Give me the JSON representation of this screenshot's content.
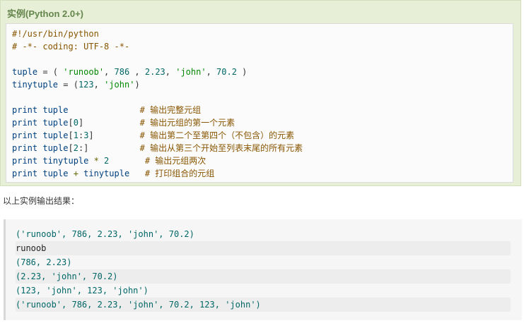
{
  "example": {
    "title": "实例(Python 2.0+)",
    "code_lines": [
      {
        "parts": [
          {
            "t": "#!/usr/bin/python",
            "c": "cm"
          }
        ]
      },
      {
        "parts": [
          {
            "t": "# -*- coding: UTF-8 -*-",
            "c": "cm"
          }
        ]
      },
      {
        "parts": []
      },
      {
        "parts": [
          {
            "t": "tuple",
            "c": "kw"
          },
          {
            "t": " = ( ",
            "c": "pl"
          },
          {
            "t": "'runoob'",
            "c": "str"
          },
          {
            "t": ", ",
            "c": "pl"
          },
          {
            "t": "786",
            "c": "num"
          },
          {
            "t": " , ",
            "c": "pl"
          },
          {
            "t": "2.23",
            "c": "num"
          },
          {
            "t": ", ",
            "c": "pl"
          },
          {
            "t": "'john'",
            "c": "str"
          },
          {
            "t": ", ",
            "c": "pl"
          },
          {
            "t": "70.2",
            "c": "num"
          },
          {
            "t": " )",
            "c": "pl"
          }
        ]
      },
      {
        "parts": [
          {
            "t": "tinytuple",
            "c": "kw"
          },
          {
            "t": " = (",
            "c": "pl"
          },
          {
            "t": "123",
            "c": "num"
          },
          {
            "t": ", ",
            "c": "pl"
          },
          {
            "t": "'john'",
            "c": "str"
          },
          {
            "t": ")",
            "c": "pl"
          }
        ]
      },
      {
        "parts": []
      },
      {
        "parts": [
          {
            "t": "print tuple              ",
            "c": "kw"
          },
          {
            "t": "# 输出完整元组",
            "c": "cm"
          }
        ]
      },
      {
        "parts": [
          {
            "t": "print tuple",
            "c": "kw"
          },
          {
            "t": "[",
            "c": "pl"
          },
          {
            "t": "0",
            "c": "num"
          },
          {
            "t": "]           ",
            "c": "pl"
          },
          {
            "t": "# 输出元组的第一个元素",
            "c": "cm"
          }
        ]
      },
      {
        "parts": [
          {
            "t": "print tuple",
            "c": "kw"
          },
          {
            "t": "[",
            "c": "pl"
          },
          {
            "t": "1",
            "c": "num"
          },
          {
            "t": ":",
            "c": "pl"
          },
          {
            "t": "3",
            "c": "num"
          },
          {
            "t": "]         ",
            "c": "pl"
          },
          {
            "t": "# 输出第二个至第四个（不包含）的元素",
            "c": "cm"
          }
        ]
      },
      {
        "parts": [
          {
            "t": "print tuple",
            "c": "kw"
          },
          {
            "t": "[",
            "c": "pl"
          },
          {
            "t": "2",
            "c": "num"
          },
          {
            "t": ":]          ",
            "c": "pl"
          },
          {
            "t": "# 输出从第三个开始至列表末尾的所有元素",
            "c": "cm"
          }
        ]
      },
      {
        "parts": [
          {
            "t": "print tinytuple ",
            "c": "kw"
          },
          {
            "t": "* ",
            "c": "op"
          },
          {
            "t": "2",
            "c": "num"
          },
          {
            "t": "       ",
            "c": "pl"
          },
          {
            "t": "# 输出元组两次",
            "c": "cm"
          }
        ]
      },
      {
        "parts": [
          {
            "t": "print tuple ",
            "c": "kw"
          },
          {
            "t": "+ ",
            "c": "op"
          },
          {
            "t": "tinytuple   ",
            "c": "kw"
          },
          {
            "t": "# 打印组合的元组",
            "c": "cm"
          }
        ]
      }
    ]
  },
  "intro_text": "以上实例输出结果：",
  "output_lines": [
    "('runoob', 786, 2.23, 'john', 70.2)",
    "runoob",
    "(786, 2.23)",
    "(2.23, 'john', 70.2)",
    "(123, 'john', 123, 'john')",
    "('runoob', 786, 2.23, 'john', 70.2, 123, 'john')"
  ]
}
